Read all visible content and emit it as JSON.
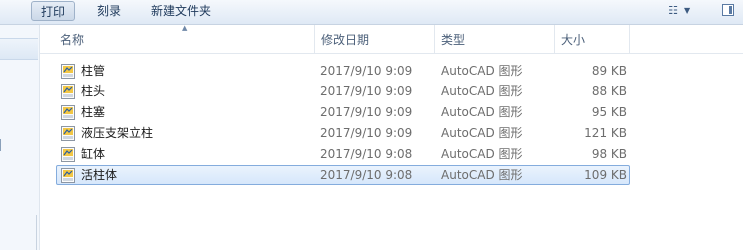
{
  "toolbar": {
    "print_label": "打印",
    "burn_label": "刻录",
    "new_folder_label": "新建文件夹"
  },
  "columns": {
    "name": "名称",
    "modified": "修改日期",
    "type": "类型",
    "size": "大小"
  },
  "files": [
    {
      "name": "柱管",
      "modified": "2017/9/10 9:09",
      "type": "AutoCAD 图形",
      "size": "89 KB"
    },
    {
      "name": "柱头",
      "modified": "2017/9/10 9:09",
      "type": "AutoCAD 图形",
      "size": "88 KB"
    },
    {
      "name": "柱塞",
      "modified": "2017/9/10 9:09",
      "type": "AutoCAD 图形",
      "size": "95 KB"
    },
    {
      "name": "液压支架立柱",
      "modified": "2017/9/10 9:09",
      "type": "AutoCAD 图形",
      "size": "121 KB"
    },
    {
      "name": "缸体",
      "modified": "2017/9/10 9:08",
      "type": "AutoCAD 图形",
      "size": "98 KB"
    },
    {
      "name": "活柱体",
      "modified": "2017/9/10 9:08",
      "type": "AutoCAD 图形",
      "size": "109 KB"
    }
  ],
  "icons": {
    "file": "dwg-file-icon",
    "view_menu": "view-options-icon",
    "preview_pane": "preview-pane-icon"
  },
  "colors": {
    "selection_border": "#84acdd",
    "selection_fill": "#d6e7fb",
    "header_text": "#4c607a"
  }
}
